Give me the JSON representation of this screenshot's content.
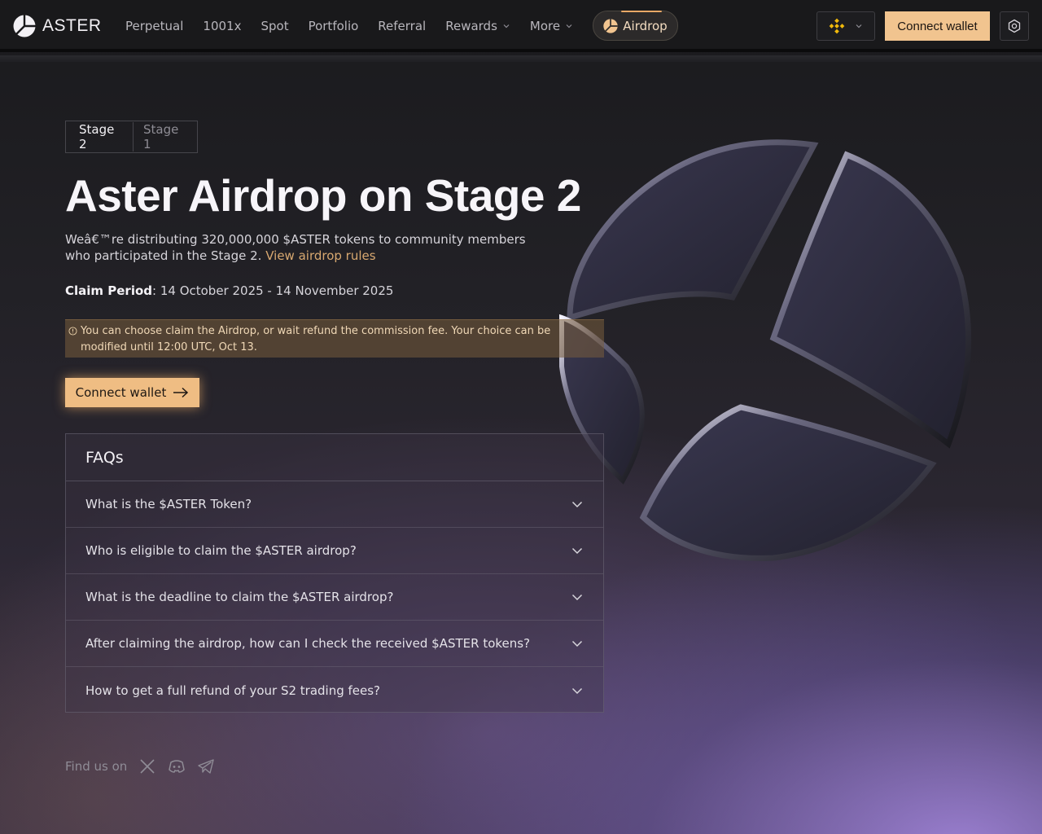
{
  "brand": {
    "name": "ASTER"
  },
  "nav": {
    "links": [
      {
        "label": "Perpetual",
        "dropdown": false
      },
      {
        "label": "1001x",
        "dropdown": false
      },
      {
        "label": "Spot",
        "dropdown": false
      },
      {
        "label": "Portfolio",
        "dropdown": false
      },
      {
        "label": "Referral",
        "dropdown": false
      },
      {
        "label": "Rewards",
        "dropdown": true
      },
      {
        "label": "More",
        "dropdown": true
      }
    ],
    "airdrop_label": "Airdrop",
    "chain_icon": "bnb-chain-icon",
    "connect_label": "Connect wallet",
    "settings_icon": "settings-icon"
  },
  "stages": {
    "active": "Stage 2",
    "inactive": "Stage 1"
  },
  "hero": {
    "title": "Aster Airdrop on Stage 2",
    "desc_text": "Weâ€™re distributing 320,000,000 $ASTER tokens to community members who participated in the Stage 2.",
    "rules_link": "View airdrop rules",
    "claim_label": "Claim Period",
    "claim_value": ": 14 October 2025 - 14 November 2025",
    "notice": "You can choose claim the Airdrop, or wait refund the commission fee. Your choice can be modified until 12:00 UTC, Oct 13.",
    "connect_label": "Connect wallet"
  },
  "faq": {
    "title": "FAQs",
    "items": [
      "What is the $ASTER Token?",
      "Who is eligible to claim the $ASTER airdrop?",
      "What is the deadline to claim the $ASTER airdrop?",
      "After claiming the airdrop, how can I check the received $ASTER tokens?",
      "How to get a full refund of your S2 trading fees?"
    ]
  },
  "footer": {
    "find_us": "Find us on",
    "socials": [
      "x-icon",
      "discord-icon",
      "telegram-icon"
    ]
  },
  "colors": {
    "accent": "#f1c48f",
    "link": "#d8a870",
    "notice_bg": "#785c3c"
  }
}
